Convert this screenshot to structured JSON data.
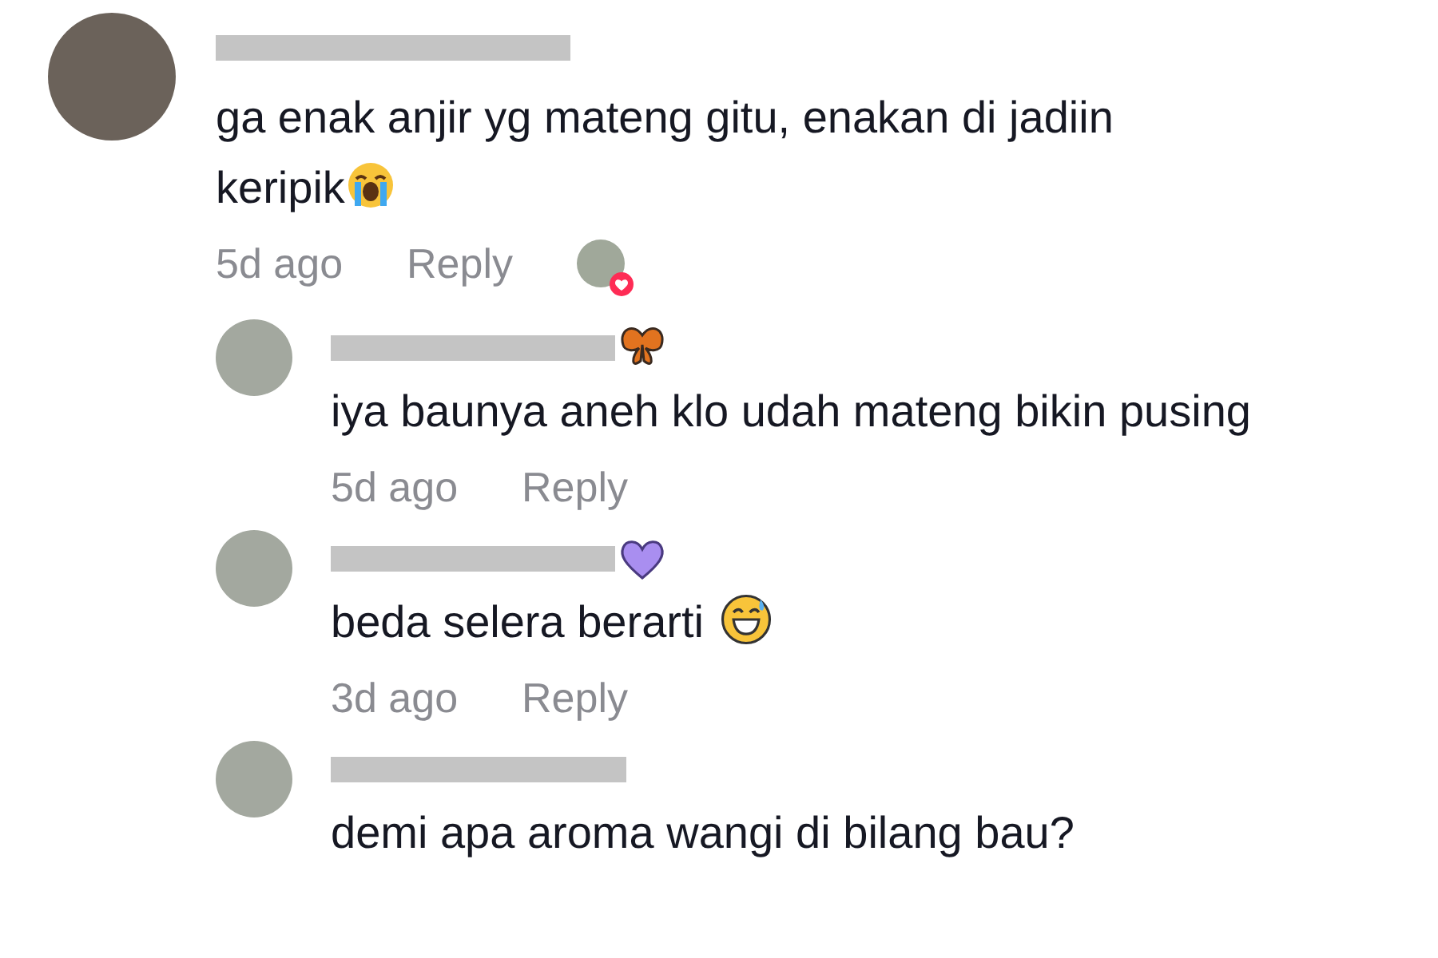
{
  "comment": {
    "name_redacted": true,
    "text": "ga enak anjir yg mateng gitu, enakan di jadiin keripik",
    "text_emoji": {
      "kind": "crying"
    },
    "time": "5d ago",
    "reply_label": "Reply",
    "liked_by_creator": true
  },
  "replies": [
    {
      "name_redacted": true,
      "name_badge": {
        "kind": "butterfly"
      },
      "text": "iya baunya aneh klo udah mateng bikin pusing",
      "time": "5d ago",
      "reply_label": "Reply"
    },
    {
      "name_redacted": true,
      "name_badge": {
        "kind": "heart"
      },
      "text": "beda selera berarti",
      "text_emoji": {
        "kind": "sweat-grin"
      },
      "time": "3d ago",
      "reply_label": "Reply"
    },
    {
      "name_redacted": true,
      "text": "demi apa aroma wangi di bilang bau?"
    }
  ]
}
